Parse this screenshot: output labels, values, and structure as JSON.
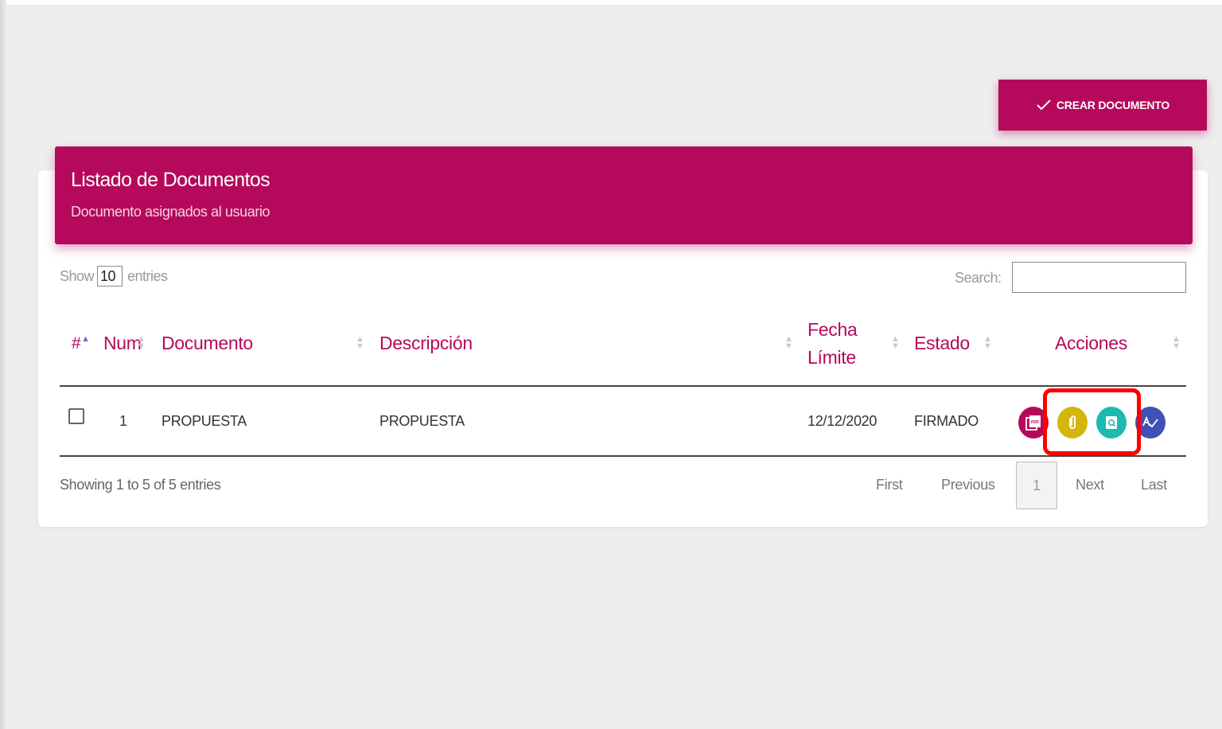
{
  "toolbar": {
    "create_label": "CREAR DOCUMENTO"
  },
  "card": {
    "title": "Listado de Documentos",
    "subtitle": "Documento asignados al usuario"
  },
  "table_controls": {
    "show_label": "Show",
    "entries_value": "10",
    "entries_label": "entries",
    "search_label": "Search:",
    "search_value": ""
  },
  "columns": {
    "hash": "#",
    "num": "Num",
    "documento": "Documento",
    "descripcion": "Descripción",
    "fecha_line1": "Fecha",
    "fecha_line2": "Límite",
    "estado": "Estado",
    "acciones": "Acciones"
  },
  "rows": [
    {
      "checked": false,
      "num": "1",
      "documento": "PROPUESTA",
      "descripcion": "PROPUESTA",
      "fecha_limite": "12/12/2020",
      "estado": "FIRMADO",
      "actions": [
        {
          "icon": "pdf-icon",
          "color": "#b5095b"
        },
        {
          "icon": "paperclip-icon",
          "color": "#d4b50a"
        },
        {
          "icon": "document-search-icon",
          "color": "#1cbab0"
        },
        {
          "icon": "signature-icon",
          "color": "#3f51b5"
        }
      ]
    }
  ],
  "footer": {
    "info": "Showing 1 to 5 of 5 entries",
    "first": "First",
    "previous": "Previous",
    "current_page": "1",
    "next": "Next",
    "last": "Last"
  },
  "colors": {
    "accent": "#b5095b",
    "highlight": "#ff0000",
    "background": "#ededed"
  }
}
